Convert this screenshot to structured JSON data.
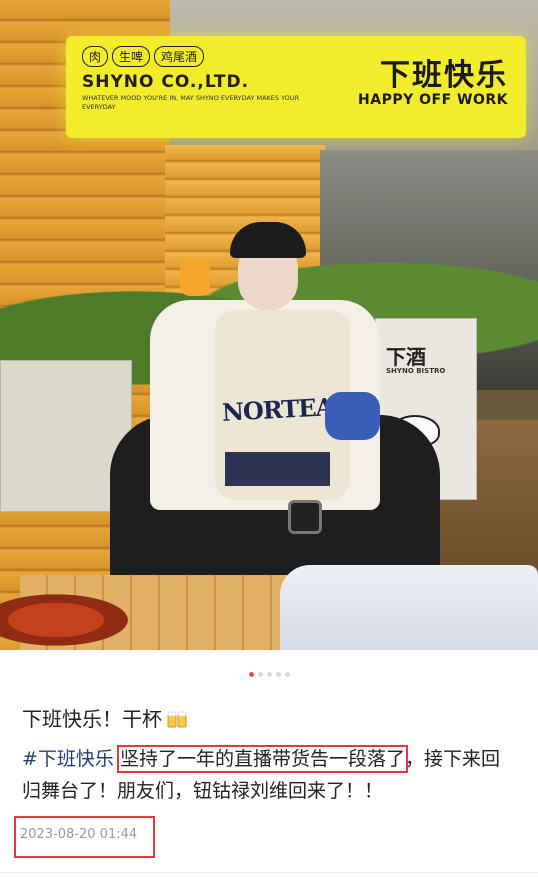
{
  "photo": {
    "sign": {
      "tags": [
        "肉",
        "生啤",
        "鸡尾酒"
      ],
      "company": "SHYNO CO.,LTD.",
      "slogan": "WHATEVER MOOD YOU'RE IN, MAY SHYNO EVERYDAY MAKES YOUR EVERYDAY",
      "title_cn": "下班快乐",
      "title_en": "HAPPY OFF WORK"
    },
    "planter_brand": "下酒",
    "planter_brand_en": "SHYNO BISTRO",
    "vest_text": "NORTEA"
  },
  "carousel": {
    "total": 5,
    "active_index": 0
  },
  "post": {
    "title": "下班快乐！干杯",
    "hashtag": "#下班快乐",
    "highlighted": "坚持了一年的直播带货告一段落了",
    "rest": "，接下来回归舞台了！朋友们，钮钴禄刘维回来了！！",
    "timestamp": "2023-08-20 01:44"
  },
  "colors": {
    "hashtag": "#223f7c",
    "highlight_box": "#e03a3a",
    "carousel_active": "#f0485c",
    "timestamp": "#9a9a9a"
  },
  "icons": [
    "beer-cheers-icon"
  ]
}
